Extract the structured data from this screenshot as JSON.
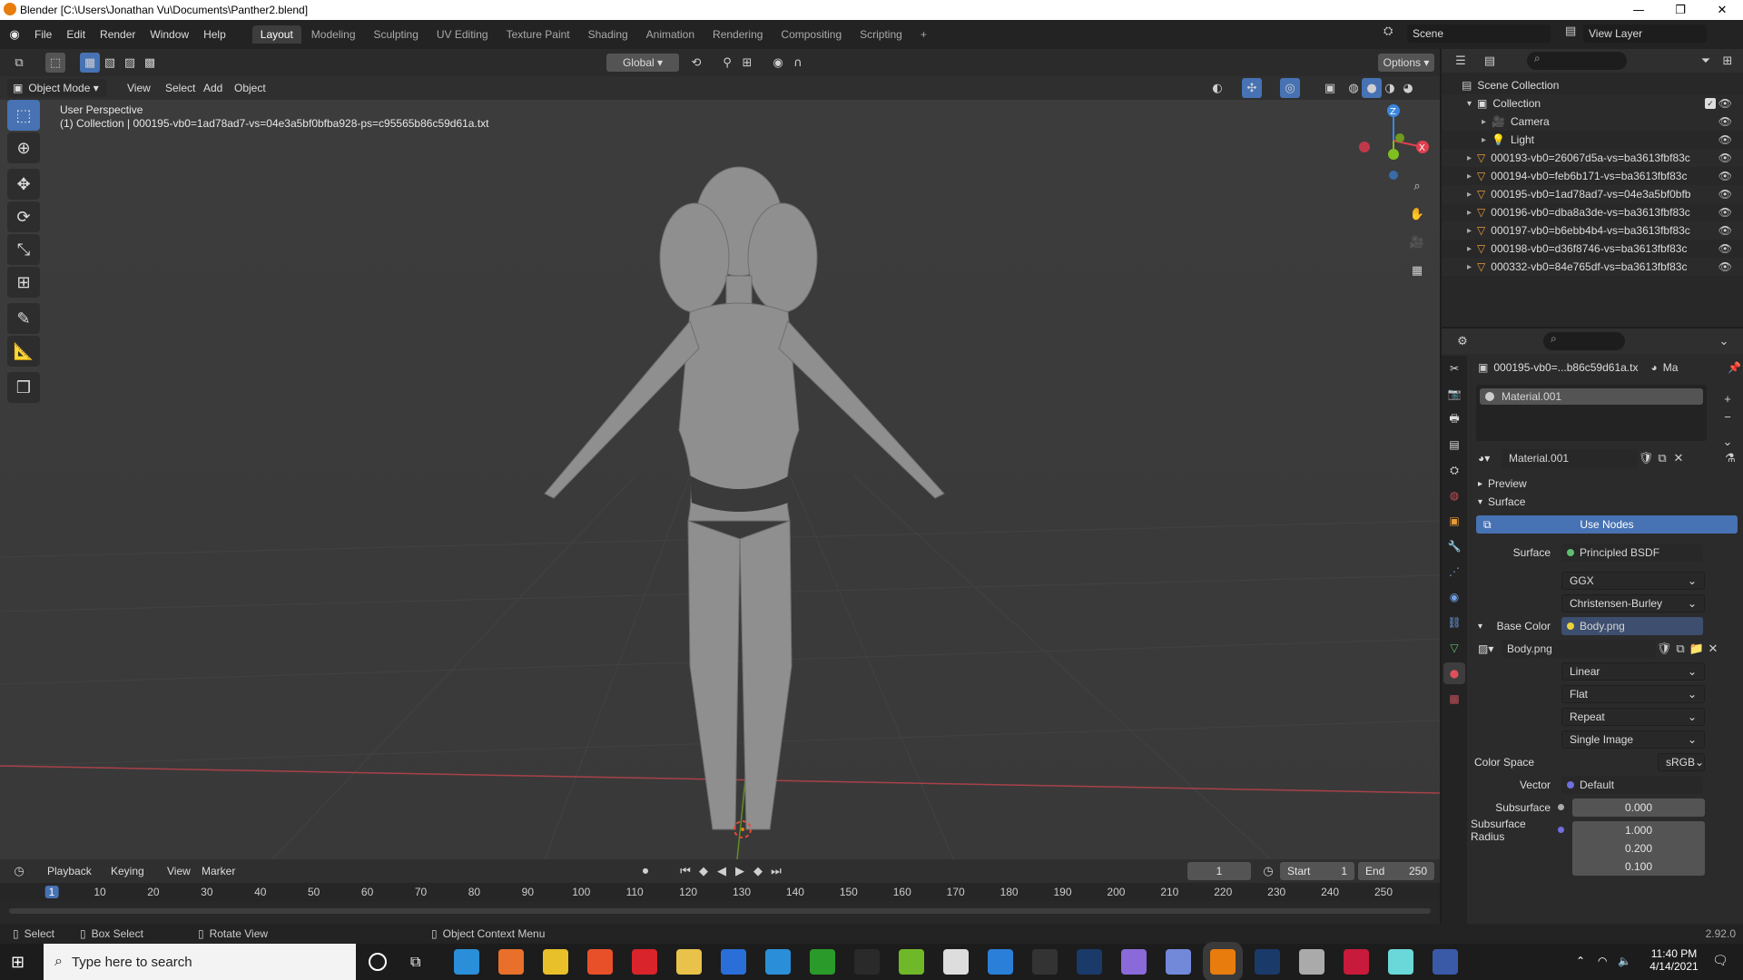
{
  "window": {
    "title": "Blender [C:\\Users\\Jonathan Vu\\Documents\\Panther2.blend]",
    "controls": [
      "—",
      "❐",
      "✕"
    ]
  },
  "menubar": {
    "menus": [
      "File",
      "Edit",
      "Render",
      "Window",
      "Help"
    ],
    "workspaces": [
      "Layout",
      "Modeling",
      "Sculpting",
      "UV Editing",
      "Texture Paint",
      "Shading",
      "Animation",
      "Rendering",
      "Compositing",
      "Scripting"
    ],
    "active_workspace": "Layout",
    "add_tab": "+",
    "scene": "Scene",
    "view_layer": "View Layer"
  },
  "viewport_header": {
    "mode": "Object Mode",
    "menus": [
      "View",
      "Select",
      "Add",
      "Object"
    ],
    "transform_orientation": "Global",
    "options": "Options"
  },
  "viewport": {
    "perspective_label": "User Perspective",
    "collection_label": "(1) Collection | 000195-vb0=1ad78ad7-vs=04e3a5bf0bfba928-ps=c95565b86c59d61a.txt",
    "gizmo": {
      "z": "Z",
      "x": "X"
    }
  },
  "outliner": {
    "root": "Scene Collection",
    "collection": "Collection",
    "items": [
      {
        "name": "Camera",
        "icon": "camera-icon"
      },
      {
        "name": "Light",
        "icon": "light-icon"
      },
      {
        "name": "000193-vb0=26067d5a-vs=ba3613fbf83c",
        "icon": "mesh-icon"
      },
      {
        "name": "000194-vb0=feb6b171-vs=ba3613fbf83c",
        "icon": "mesh-icon"
      },
      {
        "name": "000195-vb0=1ad78ad7-vs=04e3a5bf0bfb",
        "icon": "mesh-icon"
      },
      {
        "name": "000196-vb0=dba8a3de-vs=ba3613fbf83c",
        "icon": "mesh-icon"
      },
      {
        "name": "000197-vb0=b6ebb4b4-vs=ba3613fbf83c",
        "icon": "mesh-icon"
      },
      {
        "name": "000198-vb0=d36f8746-vs=ba3613fbf83c",
        "icon": "mesh-icon"
      },
      {
        "name": "000332-vb0=84e765df-vs=ba3613fbf83c",
        "icon": "mesh-icon"
      }
    ]
  },
  "properties": {
    "object_name": "000195-vb0=...b86c59d61a.tx",
    "material_short": "Ma",
    "slot": "Material.001",
    "material_name": "Material.001",
    "preview": "Preview",
    "surface_panel": "Surface",
    "use_nodes": "Use Nodes",
    "surface_label": "Surface",
    "surface_value": "Principled BSDF",
    "distribution": "GGX",
    "subsurface_method": "Christensen-Burley",
    "base_color_label": "Base Color",
    "base_color_value": "Body.png",
    "image_name": "Body.png",
    "interpolation": "Linear",
    "projection": "Flat",
    "extension": "Repeat",
    "source": "Single Image",
    "color_space_label": "Color Space",
    "color_space_value": "sRGB",
    "vector_label": "Vector",
    "vector_value": "Default",
    "subsurface_label": "Subsurface",
    "subsurface_value": "0.000",
    "subsurface_radius_label": "Subsurface Radius",
    "subsurface_radius": [
      "1.000",
      "0.200",
      "0.100"
    ]
  },
  "timeline": {
    "menus": [
      "Playback",
      "Keying",
      "View",
      "Marker"
    ],
    "current_frame": "1",
    "start_label": "Start",
    "start_value": "1",
    "end_label": "End",
    "end_value": "250",
    "ticks": [
      "1",
      "10",
      "20",
      "30",
      "40",
      "50",
      "60",
      "70",
      "80",
      "90",
      "100",
      "110",
      "120",
      "130",
      "140",
      "150",
      "160",
      "170",
      "180",
      "190",
      "200",
      "210",
      "220",
      "230",
      "240",
      "250"
    ]
  },
  "statusbar": {
    "select": "Select",
    "box_select": "Box Select",
    "rotate_view": "Rotate View",
    "context_menu": "Object Context Menu",
    "version": "2.92.0"
  },
  "taskbar": {
    "search_placeholder": "Type here to search",
    "time": "11:40 PM",
    "date": "4/14/2021"
  },
  "colors": {
    "accent": "#4772b3",
    "x_axis": "#e0404f",
    "y_axis": "#7fbf1f",
    "z_axis": "#3a87e0",
    "orange": "#e87d0d"
  }
}
